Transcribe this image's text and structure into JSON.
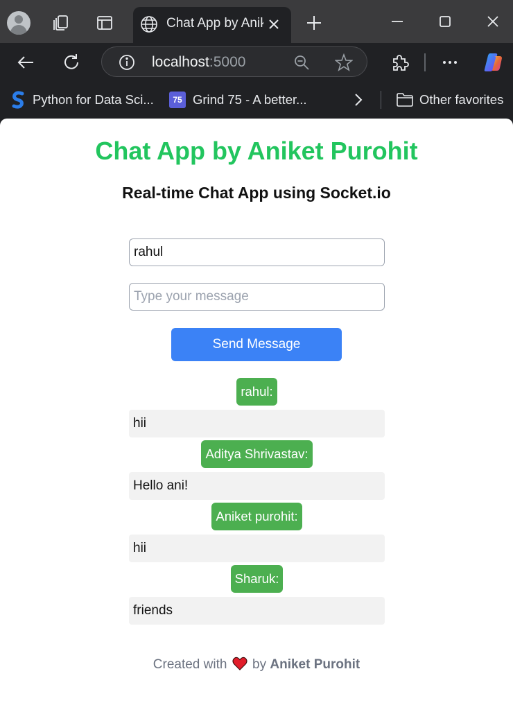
{
  "browser": {
    "tab_title": "Chat App by Aniket Purohit",
    "url_host": "localhost",
    "url_port": ":5000",
    "bookmarks": [
      {
        "label": "Python for Data Sci...",
        "icon": "s-icon"
      },
      {
        "label": "Grind 75 - A better...",
        "icon": "grind75-icon",
        "badge": "75"
      }
    ],
    "other_favorites": "Other favorites"
  },
  "app": {
    "title": "Chat App by Aniket Purohit",
    "subtitle": "Real-time Chat App using Socket.io",
    "name_value": "rahul",
    "message_placeholder": "Type your message",
    "send_label": "Send Message",
    "messages": [
      {
        "sender": "rahul:",
        "text": "hii"
      },
      {
        "sender": "Aditya Shrivastav:",
        "text": "Hello ani!"
      },
      {
        "sender": "Aniket purohit:",
        "text": "hii"
      },
      {
        "sender": "Sharuk:",
        "text": "friends"
      }
    ],
    "footer_prefix": "Created with",
    "footer_by": "by",
    "footer_author": "Aniket Purohit"
  },
  "colors": {
    "title": "#22c55e",
    "button": "#3b82f6",
    "sender_badge": "#4caf50",
    "message_bg": "#f2f2f2"
  }
}
